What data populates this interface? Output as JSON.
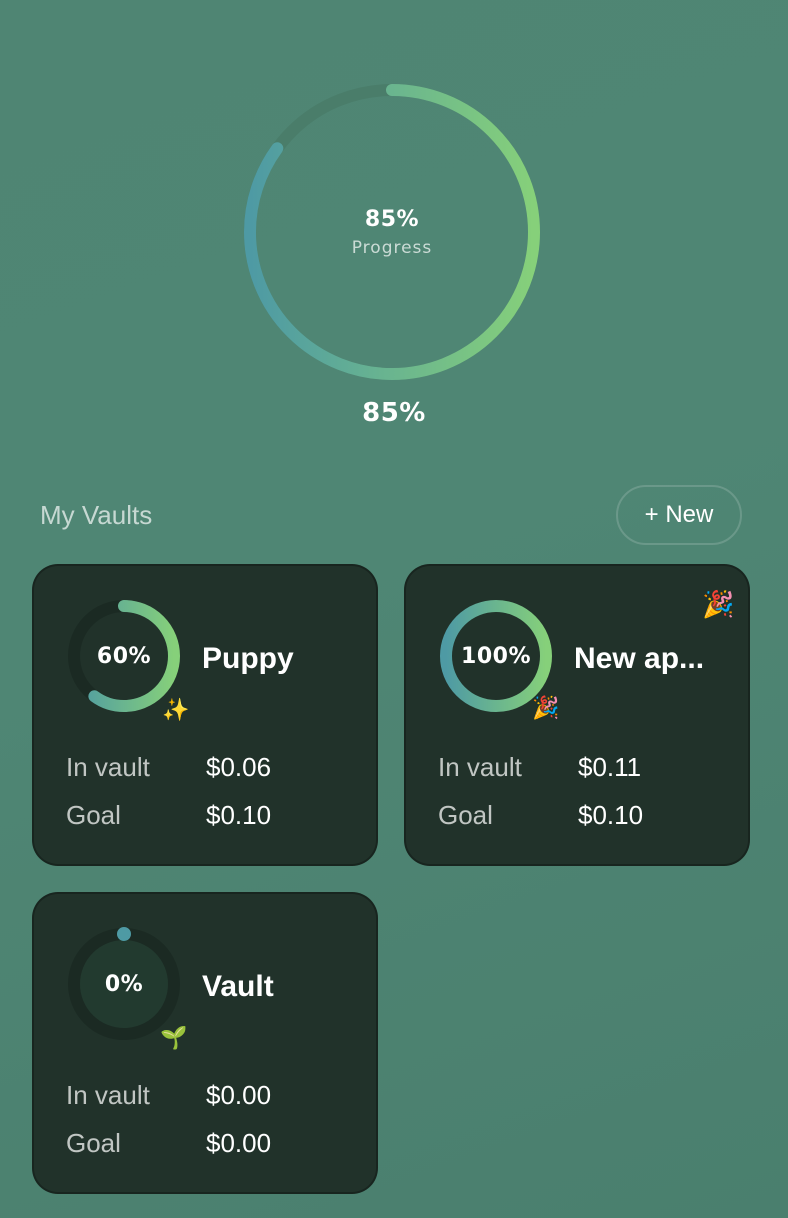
{
  "hero": {
    "progress": 0.85,
    "percent_label": "85%",
    "caption": "Progress",
    "below_label": "85%",
    "colors": {
      "track": "#4a7d6a",
      "start": "#4e9aa4",
      "end": "#86d07a"
    }
  },
  "vaults": {
    "title": "My Vaults",
    "new_button": "+ New",
    "items": [
      {
        "name": "Puppy",
        "percent": "60%",
        "progress": 0.6,
        "badge": "✨",
        "in_vault_label": "In vault",
        "in_vault": "$0.06",
        "goal_label": "Goal",
        "goal": "$0.10"
      },
      {
        "name": "New ap...",
        "percent": "100%",
        "progress": 1.0,
        "badge": "🎉",
        "corner_badge": "🎉",
        "in_vault_label": "In vault",
        "in_vault": "$0.11",
        "goal_label": "Goal",
        "goal": "$0.10"
      },
      {
        "name": "Vault",
        "percent": "0%",
        "progress": 0.0,
        "badge": "🌱",
        "in_vault_label": "In vault",
        "in_vault": "$0.00",
        "goal_label": "Goal",
        "goal": "$0.00"
      }
    ],
    "colors": {
      "card_bg": "#21322a",
      "ring_track": "#1b2a23",
      "ring_start": "#4e9aa4",
      "ring_end": "#86d07a"
    }
  }
}
